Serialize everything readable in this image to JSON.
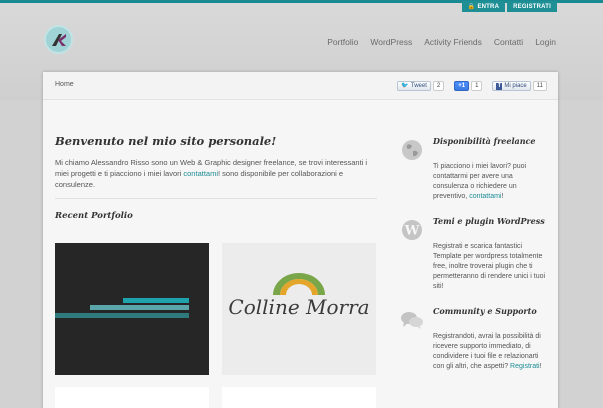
{
  "auth": {
    "login": "ENTRA",
    "register": "REGISTRATI"
  },
  "nav": [
    "Portfolio",
    "WordPress",
    "Activity Friends",
    "Contatti",
    "Login"
  ],
  "breadcrumb": "Home",
  "social": {
    "tweet_label": "Tweet",
    "tweet_count": "2",
    "gplus_label": "+1",
    "gplus_count": "1",
    "fb_label": "Mi piace",
    "fb_count": "11"
  },
  "main": {
    "title": "Benvenuto nel mio sito personale!",
    "intro_before": "Mi chiamo Alessandro Risso sono un Web & Graphic designer freelance, se trovi interessanti i miei progetti e ti piacciono i miei lavori ",
    "intro_link": "contattami",
    "intro_after": "! sono disponibile per collaborazioni e consulenze.",
    "recent_title": "Recent Portfolio",
    "portfolio_brand": "Colline Morra"
  },
  "sidebar": [
    {
      "icon": "globe-icon",
      "title": "Disponibilità freelance",
      "text": "Ti piacciono i miei lavori? puoi contattarmi per avere una consulenza o richiedere un preventivo, ",
      "link": "contattami",
      "after": "!"
    },
    {
      "icon": "wordpress-icon",
      "title": "Temi e plugin WordPress",
      "text": "Registrati e scarica fantastici Template per wordpress totalmente free, inoltre troverai plugin che ti permetteranno di rendere unici i tuoi siti!",
      "link": "",
      "after": ""
    },
    {
      "icon": "chat-bubbles-icon",
      "title": "Community e Supporto",
      "text": "Registrandoti, avrai la possibilità di ricevere supporto immediato, di condividere i tuoi file e relazionarti con gli altri, che aspetti? ",
      "link": "Registrati",
      "after": "!"
    }
  ],
  "colors": {
    "accent": "#1b8c95",
    "teal": "#1f8f96"
  }
}
